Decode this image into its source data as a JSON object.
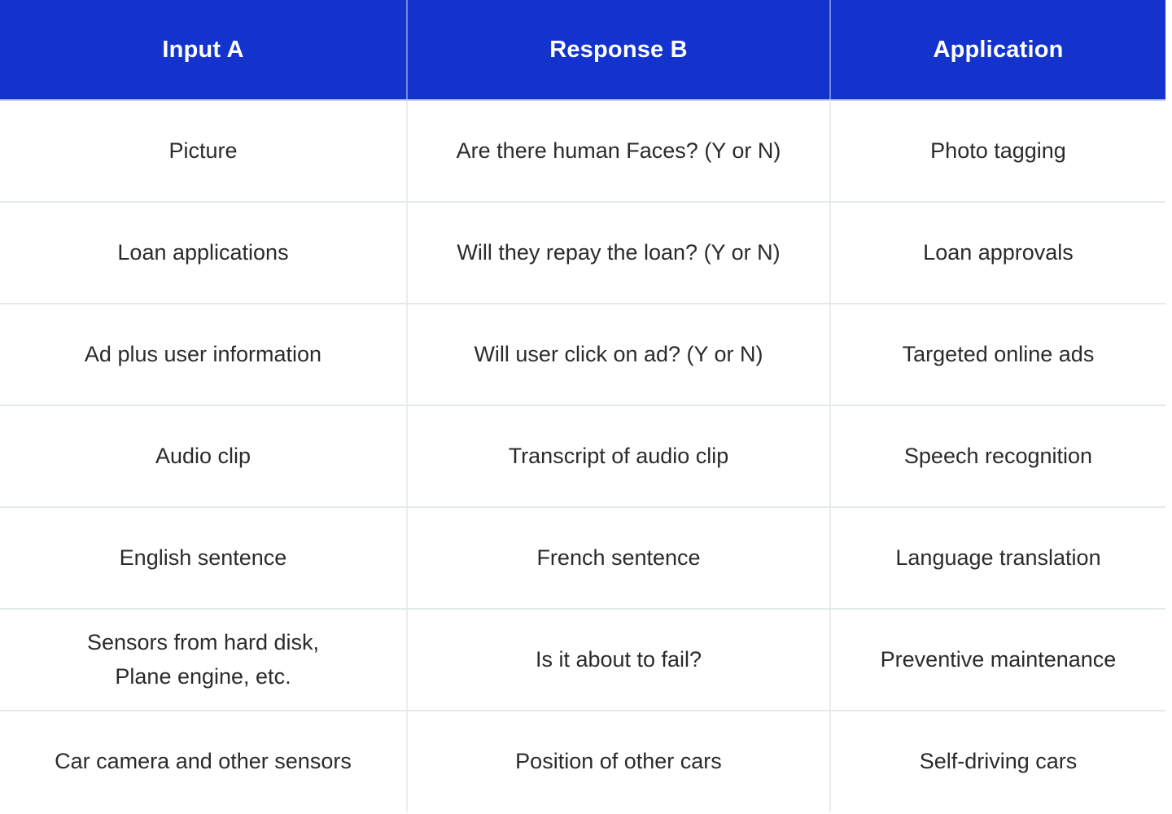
{
  "table": {
    "columns": [
      {
        "label": "Input A"
      },
      {
        "label": "Response B"
      },
      {
        "label": "Application"
      }
    ],
    "header_bg": "#1333cc",
    "header_text_color": "#ffffff",
    "body_text_color": "#2b2b2b",
    "divider_color": "#e9edf1",
    "rows": [
      {
        "input": "Picture",
        "response": "Are there human Faces? (Y or N)",
        "application": "Photo tagging"
      },
      {
        "input": "Loan applications",
        "response": "Will they repay the loan? (Y or N)",
        "application": "Loan approvals"
      },
      {
        "input": "Ad plus user information",
        "response": "Will user click on ad? (Y or N)",
        "application": "Targeted online ads"
      },
      {
        "input": "Audio clip",
        "response": "Transcript of audio clip",
        "application": "Speech recognition"
      },
      {
        "input": "English sentence",
        "response": "French sentence",
        "application": "Language translation"
      },
      {
        "input_line1": "Sensors from hard disk,",
        "input_line2": "Plane engine, etc.",
        "response": "Is it about to fail?",
        "application": "Preventive maintenance"
      },
      {
        "input": "Car camera and other sensors",
        "response": "Position of other cars",
        "application": "Self-driving cars"
      }
    ]
  }
}
